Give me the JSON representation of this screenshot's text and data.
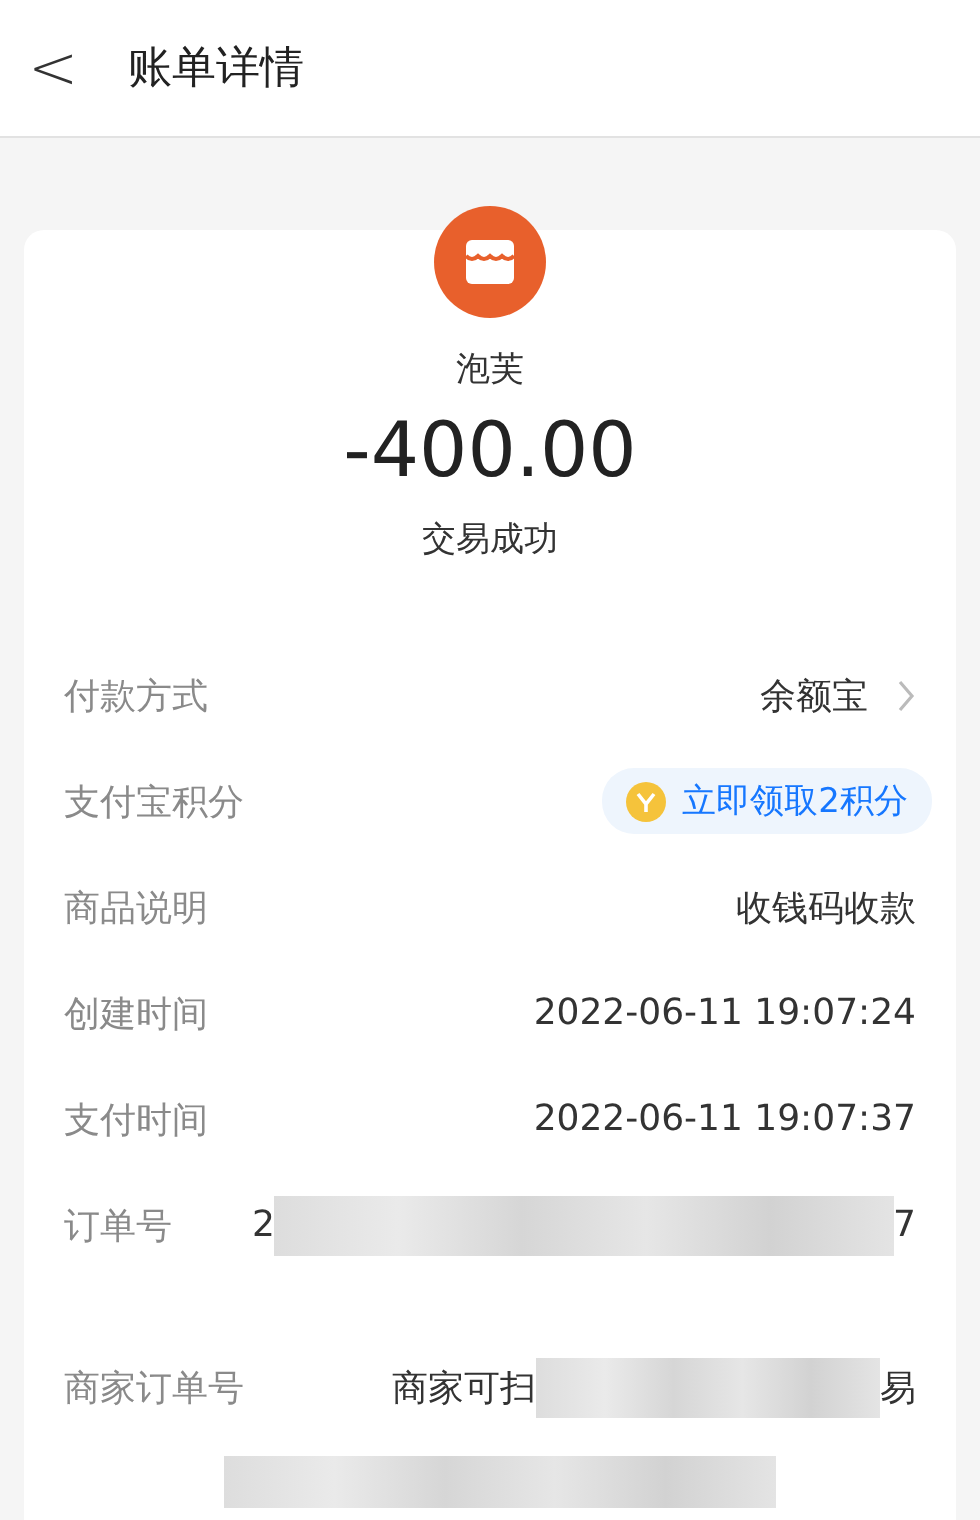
{
  "header": {
    "back": "<",
    "title": "账单详情"
  },
  "merchant": {
    "name": "泡芙",
    "amount": "-400.00",
    "status": "交易成功"
  },
  "rows": [
    {
      "kind": "link",
      "label": "付款方式",
      "value": "余额宝"
    },
    {
      "kind": "badge",
      "label": "支付宝积分",
      "value": "立即领取2积分"
    },
    {
      "kind": "text",
      "label": "商品说明",
      "value": "收钱码收款"
    },
    {
      "kind": "text",
      "label": "创建时间",
      "value": "2022-06-11 19:07:24"
    },
    {
      "kind": "text",
      "label": "支付时间",
      "value": "2022-06-11 19:07:37"
    },
    {
      "kind": "redacted",
      "label": "订单号",
      "prefix": "2",
      "suffix": "7"
    },
    {
      "kind": "redacted",
      "label": "商家订单号",
      "prefix": "商家可扫",
      "suffix": "易"
    }
  ]
}
